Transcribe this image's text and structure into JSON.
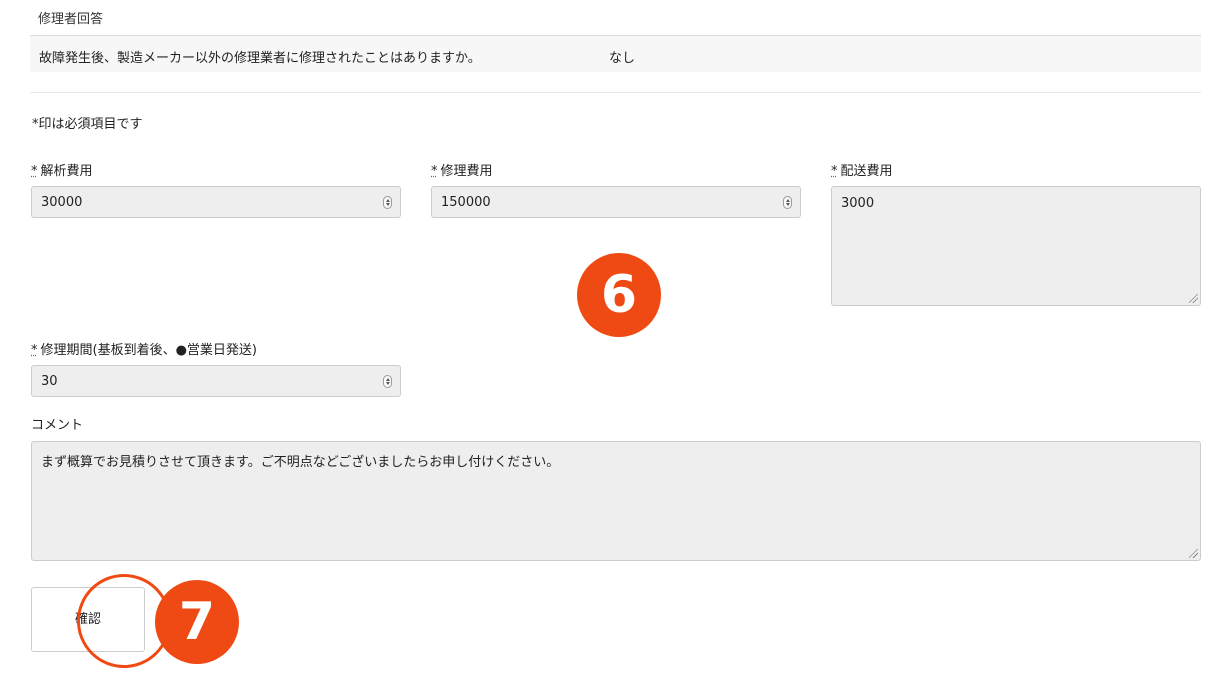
{
  "section": {
    "title": "修理者回答"
  },
  "answer": {
    "question": "故障発生後、製造メーカー以外の修理業者に修理されたことはありますか。",
    "value": "なし"
  },
  "form": {
    "required_note": "*印は必須項目です",
    "required_mark": "*",
    "analysis_fee": {
      "label": "解析費用",
      "value": "30000"
    },
    "repair_fee": {
      "label": "修理費用",
      "value": "150000"
    },
    "shipping_fee": {
      "label": "配送費用",
      "value": "3000"
    },
    "repair_period": {
      "label": "修理期間(基板到着後、●営業日発送)",
      "value": "30"
    },
    "comment": {
      "label": "コメント",
      "value": "まず概算でお見積りさせて頂きます。ご不明点などございましたらお申し付けください。"
    },
    "confirm_label": "確認"
  },
  "annotations": {
    "step_6": "6",
    "step_7": "7",
    "color": "#f04a14"
  }
}
